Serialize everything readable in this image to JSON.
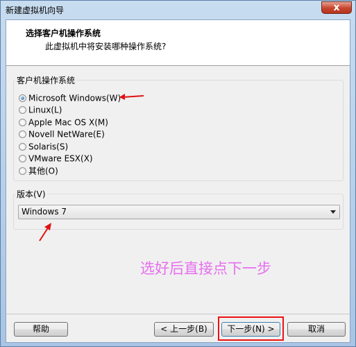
{
  "window": {
    "title": "新建虚拟机向导",
    "close_glyph": "x"
  },
  "header": {
    "title": "选择客户机操作系统",
    "subtitle": "此虚拟机中将安装哪种操作系统?"
  },
  "os_group": {
    "label": "客户机操作系统",
    "options": [
      {
        "label": "Microsoft Windows(W)",
        "selected": true
      },
      {
        "label": "Linux(L)",
        "selected": false
      },
      {
        "label": "Apple Mac OS X(M)",
        "selected": false
      },
      {
        "label": "Novell NetWare(E)",
        "selected": false
      },
      {
        "label": "Solaris(S)",
        "selected": false
      },
      {
        "label": "VMware ESX(X)",
        "selected": false
      },
      {
        "label": "其他(O)",
        "selected": false
      }
    ]
  },
  "version_group": {
    "label": "版本(V)",
    "selected": "Windows 7"
  },
  "annotation": {
    "text": "选好后直接点下一步",
    "color": "#e76ef0",
    "highlight_color": "#e11111"
  },
  "footer": {
    "help_label": "帮助",
    "back_label": "< 上一步(B)",
    "next_label": "下一步(N) >",
    "cancel_label": "取消"
  }
}
